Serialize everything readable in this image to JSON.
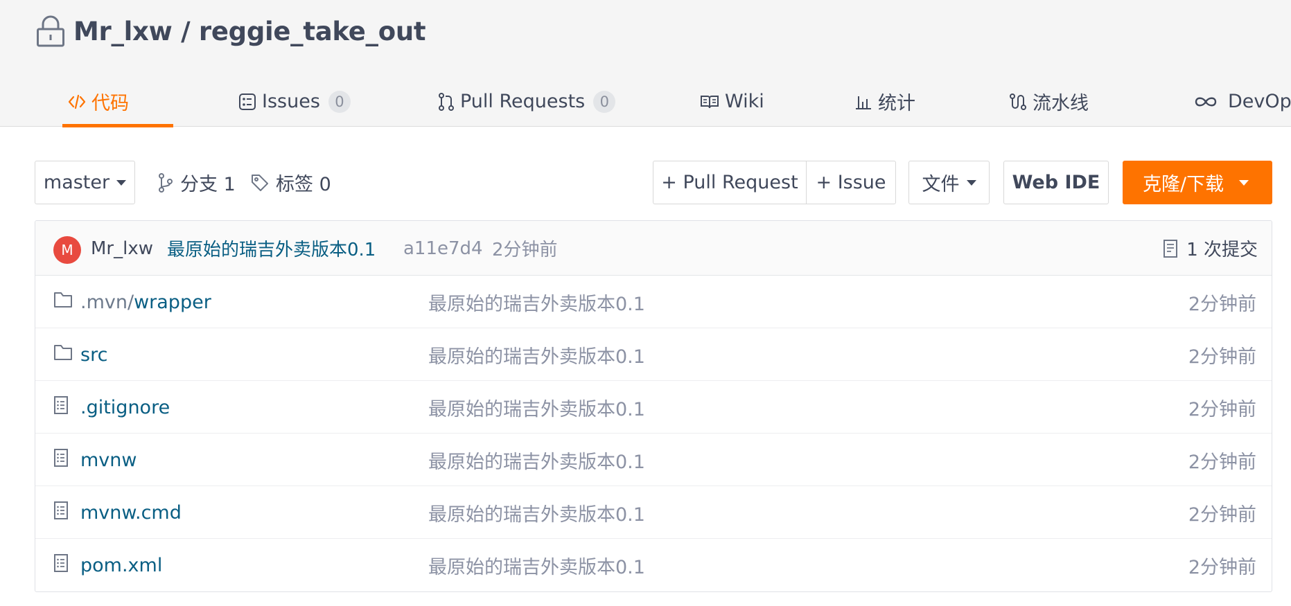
{
  "repo": {
    "owner": "Mr_lxw",
    "separator": " / ",
    "name": "reggie_take_out"
  },
  "tabs": [
    {
      "label": "代码",
      "icon": "code-icon",
      "active": true
    },
    {
      "label": "Issues",
      "icon": "issues-icon",
      "badge": "0"
    },
    {
      "label": "Pull Requests",
      "icon": "pull-request-icon",
      "badge": "0"
    },
    {
      "label": "Wiki",
      "icon": "book-icon"
    },
    {
      "label": "统计",
      "icon": "bar-chart-icon"
    },
    {
      "label": "流水线",
      "icon": "pipeline-icon"
    },
    {
      "label": "DevOps",
      "icon": "infinity-icon"
    }
  ],
  "toolbar": {
    "branch": "master",
    "branches_label": "分支 1",
    "tags_label": "标签 0",
    "pull_request_btn": "+ Pull Request",
    "issue_btn": "+ Issue",
    "file_btn": "文件",
    "webide_btn": "Web IDE",
    "clone_btn": "克隆/下载"
  },
  "latest_commit": {
    "avatar_letter": "M",
    "author": "Mr_lxw",
    "message": "最原始的瑞吉外卖版本0.1",
    "hash": "a11e7d4",
    "time": "2分钟前",
    "commit_count": "1 次提交"
  },
  "files": [
    {
      "type": "folder",
      "name_prefix": ".mvn/",
      "name": "wrapper",
      "message": "最原始的瑞吉外卖版本0.1",
      "time": "2分钟前"
    },
    {
      "type": "folder",
      "name_prefix": "",
      "name": "src",
      "message": "最原始的瑞吉外卖版本0.1",
      "time": "2分钟前"
    },
    {
      "type": "file",
      "name_prefix": "",
      "name": ".gitignore",
      "message": "最原始的瑞吉外卖版本0.1",
      "time": "2分钟前"
    },
    {
      "type": "file",
      "name_prefix": "",
      "name": "mvnw",
      "message": "最原始的瑞吉外卖版本0.1",
      "time": "2分钟前"
    },
    {
      "type": "file",
      "name_prefix": "",
      "name": "mvnw.cmd",
      "message": "最原始的瑞吉外卖版本0.1",
      "time": "2分钟前"
    },
    {
      "type": "file",
      "name_prefix": "",
      "name": "pom.xml",
      "message": "最原始的瑞吉外卖版本0.1",
      "time": "2分钟前"
    }
  ],
  "colors": {
    "accent": "#fe7300",
    "link": "#095e83",
    "text": "#40485b",
    "muted": "#8c92a4",
    "avatar": "#e84a3f"
  }
}
